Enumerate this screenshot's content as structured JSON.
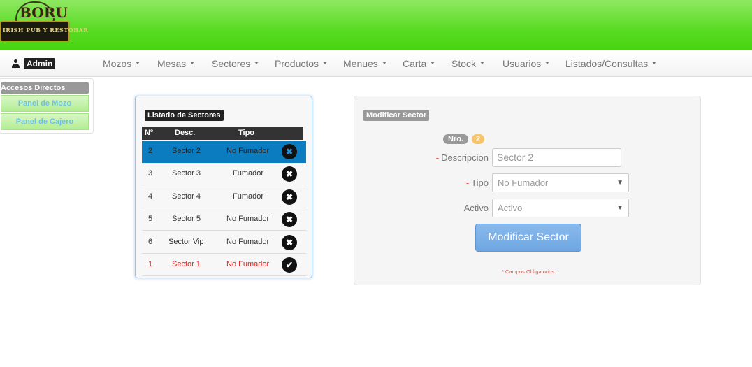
{
  "brand": {
    "logo_word": "BORU",
    "logo_tagline": "IRISH PUB Y RESTOBAR"
  },
  "user": {
    "label": "Admin",
    "icon": "user-icon"
  },
  "nav": {
    "items": [
      {
        "label": "Mozos"
      },
      {
        "label": "Mesas"
      },
      {
        "label": "Sectores"
      },
      {
        "label": "Productos"
      },
      {
        "label": "Menues"
      },
      {
        "label": "Carta"
      },
      {
        "label": "Stock"
      },
      {
        "label": "Usuarios"
      },
      {
        "label": "Listados/Consultas"
      }
    ]
  },
  "quick_access": {
    "title": "Accesos Directos",
    "buttons": [
      {
        "label": "Panel de Mozo"
      },
      {
        "label": "Panel de Cajero"
      }
    ]
  },
  "sector_list": {
    "title": "Listado de Sectores",
    "columns": [
      "Nº",
      "Desc.",
      "Tipo"
    ],
    "rows": [
      {
        "nro": "2",
        "desc": "Sector 2",
        "tipo": "No Fumador",
        "action": "✖",
        "action_icon": "remove-icon",
        "state": "selected"
      },
      {
        "nro": "3",
        "desc": "Sector 3",
        "tipo": "Fumador",
        "action": "✖",
        "action_icon": "remove-icon",
        "state": "normal"
      },
      {
        "nro": "4",
        "desc": "Sector 4",
        "tipo": "Fumador",
        "action": "✖",
        "action_icon": "remove-icon",
        "state": "normal"
      },
      {
        "nro": "5",
        "desc": "Sector 5",
        "tipo": "No Fumador",
        "action": "✖",
        "action_icon": "remove-icon",
        "state": "normal"
      },
      {
        "nro": "6",
        "desc": "Sector Vip",
        "tipo": "No Fumador",
        "action": "✖",
        "action_icon": "remove-icon",
        "state": "normal"
      },
      {
        "nro": "1",
        "desc": "Sector 1",
        "tipo": "No Fumador",
        "action": "✔",
        "action_icon": "check-icon",
        "state": "inactive"
      }
    ]
  },
  "form": {
    "title": "Modificar Sector",
    "nro_label": "Nro.",
    "nro_value": "2",
    "descripcion_label": "Descripcion",
    "descripcion_value": "Sector 2",
    "tipo_label": "Tipo",
    "tipo_value": "No Fumador",
    "activo_label": "Activo",
    "activo_value": "Activo",
    "required_marker": "-",
    "submit_label": "Modificar Sector",
    "note": "* Campos Obligatorios"
  },
  "colors": {
    "header_green": "#59db23",
    "selected_row": "#0b7cbf",
    "inactive_text": "#d9231f",
    "submit_blue": "#6fa7e3",
    "nro_badge": "#999999",
    "num_badge": "#f7c56b"
  }
}
